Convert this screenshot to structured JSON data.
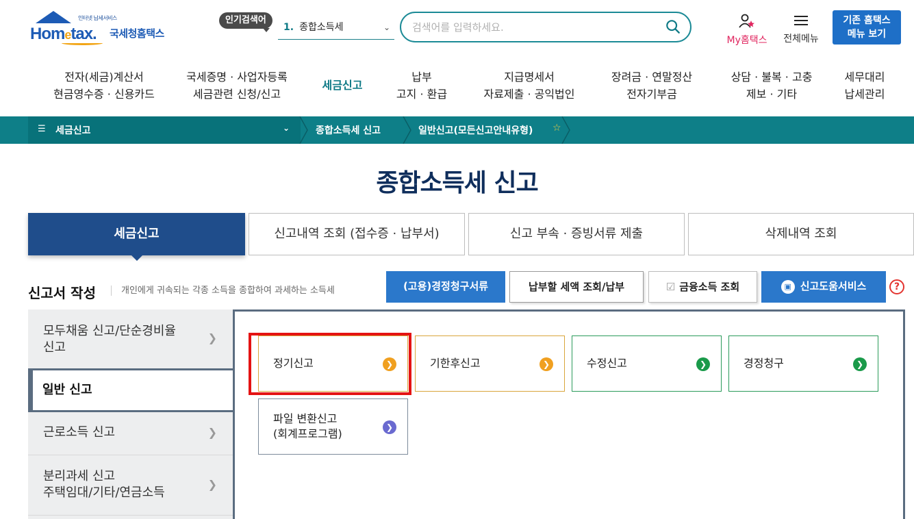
{
  "header": {
    "logo_small": "인터넷 납세서비스",
    "logo_home": "Hom",
    "logo_e": "e",
    "logo_tax": "tax.",
    "logo_kr": "국세청홈택스",
    "popular_badge": "인기검색어",
    "popular_rank": "1.",
    "popular_term": "종합소득세",
    "search_placeholder": "검색어를 입력하세요.",
    "my_hometax": "My홈택스",
    "all_menu": "전체메뉴",
    "old_menu_line1": "기존 홈택스",
    "old_menu_line2": "메뉴 보기"
  },
  "gnb": [
    {
      "line1": "전자(세금)계산서",
      "line2": "현금영수증 · 신용카드"
    },
    {
      "line1": "국세증명 · 사업자등록",
      "line2": "세금관련 신청/신고"
    },
    {
      "line1": "세금신고",
      "line2": ""
    },
    {
      "line1": "납부",
      "line2": "고지 · 환급"
    },
    {
      "line1": "지급명세서",
      "line2": "자료제출 · 공익법인"
    },
    {
      "line1": "장려금 · 연말정산",
      "line2": "전자기부금"
    },
    {
      "line1": "상담 · 불복 · 고충",
      "line2": "제보 · 기타"
    },
    {
      "line1": "세무대리",
      "line2": "납세관리"
    }
  ],
  "breadcrumb": {
    "menu": "세금신고",
    "level2": "종합소득세 신고",
    "level3": "일반신고(모든신고안내유형)"
  },
  "page_title": "종합소득세 신고",
  "tabs": [
    "세금신고",
    "신고내역 조회 (접수증 · 납부서)",
    "신고 부속 · 증빙서류 제출",
    "삭제내역 조회"
  ],
  "section": {
    "title": "신고서 작성",
    "desc": "개인에게 귀속되는 각종 소득을 종합하여 과세하는 소득세"
  },
  "actions": {
    "claim_docs": "(고용)경정청구서류",
    "pay_tax": "납부할 세액 조회/납부",
    "finance_income": "금융소득 조회",
    "help_service": "신고도움서비스",
    "help": "?"
  },
  "side_menu": [
    {
      "line1": "모두채움 신고/단순경비율",
      "line2": "신고"
    },
    {
      "line1": "일반 신고",
      "line2": ""
    },
    {
      "line1": "근로소득 신고",
      "line2": ""
    },
    {
      "line1": "분리과세 신고",
      "line2": "주택임대/기타/연금소득"
    }
  ],
  "cards": [
    {
      "label": "정기신고",
      "color": "#f0a020",
      "border": "#d9a53a"
    },
    {
      "label": "기한후신고",
      "color": "#f0a020",
      "border": "#d9a53a"
    },
    {
      "label": "수정신고",
      "color": "#1a9a4a",
      "border": "#2a9a5a"
    },
    {
      "label": "경정청구",
      "color": "#1a9a4a",
      "border": "#2a9a5a"
    },
    {
      "label1": "파일 변환신고",
      "label2": "(회계프로그램)",
      "color": "#6a6ad0",
      "border": "#7b8a9a"
    }
  ],
  "colors": {
    "accent": "#0e7f88",
    "navy": "#1f4d8b",
    "highlight": "#e41313"
  }
}
